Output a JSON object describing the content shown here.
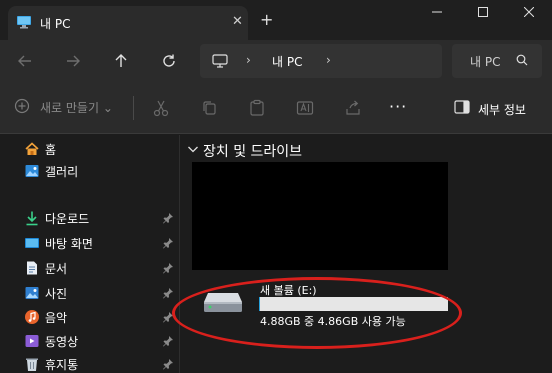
{
  "window": {
    "tab_title": "내 PC",
    "tab_close_glyph": "✕",
    "new_tab_glyph": "+"
  },
  "address": {
    "location": "내 PC",
    "separator": "›"
  },
  "search": {
    "placeholder": "내 PC"
  },
  "toolbar": {
    "new_label": "새로 만들기",
    "more_glyph": "···",
    "details_label": "세부 정보"
  },
  "sidebar": {
    "items": [
      {
        "label": "홈",
        "icon": "home-icon",
        "pinned": false
      },
      {
        "label": "갤러리",
        "icon": "gallery-icon",
        "pinned": false
      },
      {
        "label": "다운로드",
        "icon": "download-icon",
        "pinned": true
      },
      {
        "label": "바탕 화면",
        "icon": "desktop-icon",
        "pinned": true
      },
      {
        "label": "문서",
        "icon": "documents-icon",
        "pinned": true
      },
      {
        "label": "사진",
        "icon": "pictures-icon",
        "pinned": true
      },
      {
        "label": "음악",
        "icon": "music-icon",
        "pinned": true
      },
      {
        "label": "동영상",
        "icon": "videos-icon",
        "pinned": true
      },
      {
        "label": "휴지통",
        "icon": "recycle-bin-icon",
        "pinned": true
      }
    ]
  },
  "main": {
    "section_title": "장치 및 드라이브",
    "drive": {
      "name": "새 볼륨 (E:)",
      "free_text": "4.88GB 중 4.86GB 사용 가능",
      "used_fraction": 0.004
    }
  },
  "colors": {
    "accent": "#26a0da",
    "highlight": "#d9201c",
    "background": "#1c1c1c",
    "chrome": "#2b2b2b"
  }
}
